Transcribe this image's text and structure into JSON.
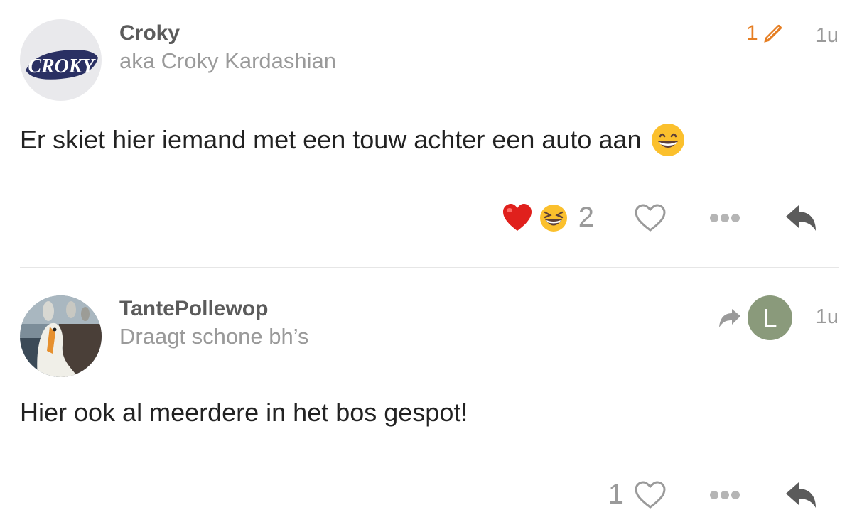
{
  "posts": [
    {
      "username": "Croky",
      "user_title": "aka Croky Kardashian",
      "avatar_logo_text": "CROKY",
      "edit_count": "1",
      "age": "1u",
      "body": "Er skiet hier iemand met een touw achter een auto aan",
      "reactions": [
        "heart",
        "laughing"
      ],
      "reaction_count": "2"
    },
    {
      "username": "TantePollewop",
      "user_title": "Draagt schone bh’s",
      "reply_to_initial": "L",
      "age": "1u",
      "body": "Hier ook al meerdere in het bos gespot!",
      "like_count": "1"
    }
  ],
  "colors": {
    "accent": "#e67e22",
    "muted": "#9a9a9a",
    "username": "#5b5b5b",
    "reply_avatar": "#8a9a7b"
  },
  "icons": [
    "pencil-icon",
    "heart-outline-icon",
    "ellipsis-icon",
    "reply-icon",
    "share-arrow-icon",
    "grinning-emoji",
    "heart-emoji",
    "laughing-emoji"
  ]
}
